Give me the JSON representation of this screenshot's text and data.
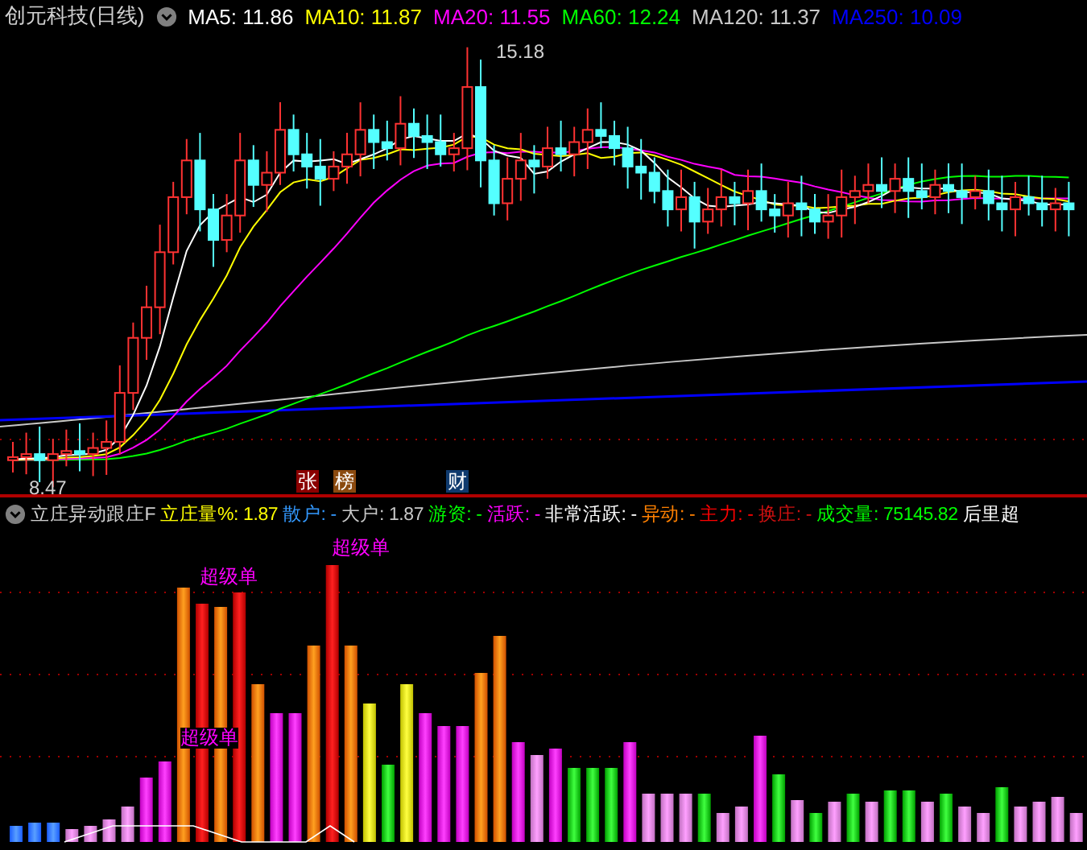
{
  "title": "创元科技(日线)",
  "ma_legend": [
    {
      "label": "MA5:",
      "value": "11.86",
      "color": "#ffffff"
    },
    {
      "label": "MA10:",
      "value": "11.87",
      "color": "#ffff00"
    },
    {
      "label": "MA20:",
      "value": "11.55",
      "color": "#ff00ff"
    },
    {
      "label": "MA60:",
      "value": "12.24",
      "color": "#00ff00"
    },
    {
      "label": "MA120:",
      "value": "11.37",
      "color": "#c8c8c8"
    },
    {
      "label": "MA250:",
      "value": "10.09",
      "color": "#0000ff"
    }
  ],
  "high_label": "15.18",
  "low_label": "8.47",
  "event_markers": [
    {
      "text": "张",
      "color": "#8b0000"
    },
    {
      "text": "榜",
      "color": "#8b4a0f"
    },
    {
      "text": "财",
      "color": "#0f3a6e"
    }
  ],
  "indicator": {
    "name": "立庄异动跟庄F",
    "legend": [
      {
        "label": "立庄量%:",
        "value": "1.87",
        "color": "#ffff00"
      },
      {
        "label": "散户:",
        "value": "-",
        "color": "#3399ff"
      },
      {
        "label": "大户:",
        "value": "1.87",
        "color": "#c8c8c8"
      },
      {
        "label": "游资:",
        "value": "-",
        "color": "#00ff00"
      },
      {
        "label": "活跃:",
        "value": "-",
        "color": "#ff00ff"
      },
      {
        "label": "非常活跃:",
        "value": "-",
        "color": "#ffffff"
      },
      {
        "label": "异动:",
        "value": "-",
        "color": "#ff8000"
      },
      {
        "label": "主力:",
        "value": "-",
        "color": "#ff0000"
      },
      {
        "label": "换庄:",
        "value": "-",
        "color": "#d01010"
      },
      {
        "label": "成交量:",
        "value": "75145.82",
        "color": "#00ff00"
      },
      {
        "label": "后里超",
        "color": "#ffffff"
      }
    ],
    "signals": [
      "超级单",
      "超级单",
      "超级单"
    ]
  }
}
